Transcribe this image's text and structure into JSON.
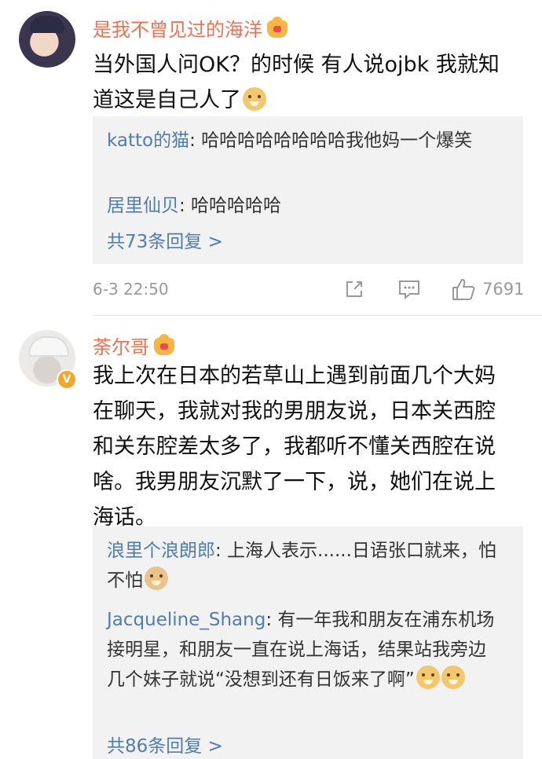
{
  "comments": [
    {
      "username": "是我不曾见过的海洋",
      "text": "当外国人问OK？的时候  有人说ojbk 我就知道这是自己人了",
      "replies": [
        {
          "name": "katto的猫",
          "text": ": 哈哈哈哈哈哈哈哈我他妈一个爆笑"
        },
        {
          "name": "居里仙贝",
          "text": ": 哈哈哈哈哈"
        }
      ],
      "more_replies": "共73条回复 >",
      "time": "6-3 22:50",
      "like_count": "7691"
    },
    {
      "username": "荼尔哥",
      "text": "我上次在日本的若草山上遇到前面几个大妈在聊天，我就对我的男朋友说，日本关西腔和关东腔差太多了，我都听不懂关西腔在说啥。我男朋友沉默了一下，说，她们在说上海话。",
      "replies": [
        {
          "name": "浪里个浪朗郎",
          "text": ": 上海人表示......日语张口就来，怕不怕"
        },
        {
          "name": "Jacqueline_Shang",
          "text": ": 有一年我和朋友在浦东机场接明星，和朋友一直在说上海话，结果站我旁边几个妹子就说“没想到还有日饭来了啊”"
        }
      ],
      "more_replies": "共86条回复 >"
    }
  ],
  "colors": {
    "username": "#eb7350",
    "reply_name": "#507daf",
    "reply_bg": "#f2f2f2"
  },
  "icons": [
    "crown-vip-icon",
    "doge-emoji-icon",
    "cat-emoji-icon",
    "share-icon",
    "comment-icon",
    "like-icon",
    "verified-badge-icon"
  ]
}
